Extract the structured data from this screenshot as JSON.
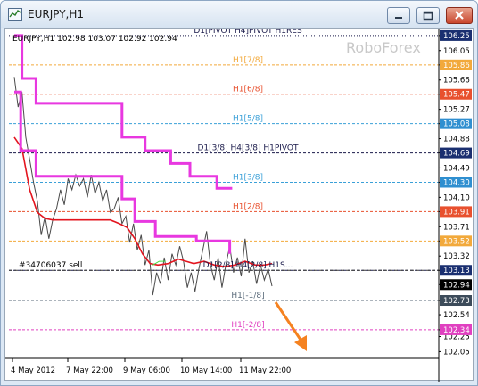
{
  "window": {
    "title": "EURJPY,H1",
    "buttons": {
      "minimize_icon": "minimize-icon",
      "maximize_icon": "maximize-icon",
      "close_icon": "close-icon"
    }
  },
  "chart_data": {
    "type": "line",
    "symbol_info": "EURJPY,H1   102.98 103.07 102.92 102.94",
    "watermark": "RoboForex",
    "ylim": [
      101.96,
      106.32
    ],
    "y_ticks": [
      "106.25",
      "106.05",
      "105.86",
      "105.66",
      "105.47",
      "105.27",
      "105.08",
      "104.88",
      "104.69",
      "104.49",
      "104.30",
      "104.10",
      "103.91",
      "103.71",
      "103.52",
      "103.32",
      "103.13",
      "102.94",
      "102.73",
      "102.54",
      "102.34",
      "102.25",
      "102.05"
    ],
    "x_ticks": [
      "4 May 2012",
      "7 May 22:00",
      "9 May 06:00",
      "10 May 14:00",
      "11 May 22:00"
    ],
    "current_price": "102.94",
    "levels": [
      {
        "label": "D1[PIVOT H4]PIVOT H1RES",
        "value": 106.25,
        "color": "#1a1a4a",
        "tag_bg": "#1a2f70",
        "style": "dot"
      },
      {
        "label": "H1[7/8]",
        "value": 105.86,
        "color": "#f2a93b",
        "tag_bg": "#f2a93b",
        "style": "dash"
      },
      {
        "label": "H1[6/8]",
        "value": 105.47,
        "color": "#e8502e",
        "tag_bg": "#e8502e",
        "style": "dash"
      },
      {
        "label": "H1[5/8]",
        "value": 105.08,
        "color": "#3aa0d8",
        "tag_bg": "#2f8fd0",
        "style": "dash"
      },
      {
        "label": "D1[3/8] H4[3/8] H1PIVOT",
        "value": 104.69,
        "color": "#1a1a4a",
        "tag_bg": "#1a2f70",
        "style": "dash"
      },
      {
        "label": "H1[3/8]",
        "value": 104.3,
        "color": "#3aa0d8",
        "tag_bg": "#2f8fd0",
        "style": "dash"
      },
      {
        "label": "H1[2/8]",
        "value": 103.91,
        "color": "#e8502e",
        "tag_bg": "#e8502e",
        "style": "dash"
      },
      {
        "label": "",
        "value": 103.52,
        "color": "#f2a93b",
        "tag_bg": "#f2a93b",
        "style": "dash"
      },
      {
        "label": "D1[2/8] H4[2/8] H1S...",
        "value": 103.13,
        "color": "#1a1a4a",
        "tag_bg": "#1a2f70",
        "style": "dash"
      },
      {
        "label": "H1[-1/8]",
        "value": 102.73,
        "color": "#5a6a7a",
        "tag_bg": "#3c4b5a",
        "style": "dash"
      },
      {
        "label": "H1[-2/8]",
        "value": 102.34,
        "color": "#e040c0",
        "tag_bg": "#e040c0",
        "style": "dash"
      }
    ],
    "trade_line": {
      "label": "#34706037 sell",
      "value": 103.13
    },
    "series": [
      {
        "name": "",
        "color": "#4a4a4a",
        "kind": "price",
        "points": [
          [
            0,
            105.7
          ],
          [
            3,
            105.3
          ],
          [
            6,
            105.5
          ],
          [
            9,
            104.9
          ],
          [
            12,
            104.6
          ],
          [
            15,
            104.3
          ],
          [
            18,
            104.05
          ],
          [
            21,
            103.6
          ],
          [
            24,
            103.85
          ],
          [
            27,
            103.55
          ],
          [
            30,
            103.8
          ],
          [
            33,
            103.95
          ],
          [
            36,
            104.2
          ],
          [
            39,
            104.0
          ],
          [
            42,
            104.35
          ],
          [
            45,
            104.2
          ],
          [
            48,
            104.4
          ],
          [
            51,
            104.25
          ],
          [
            54,
            104.35
          ],
          [
            57,
            104.1
          ],
          [
            60,
            104.4
          ],
          [
            63,
            104.15
          ],
          [
            66,
            104.3
          ],
          [
            69,
            104.05
          ],
          [
            72,
            104.2
          ],
          [
            75,
            103.9
          ],
          [
            78,
            103.95
          ],
          [
            81,
            104.1
          ],
          [
            84,
            103.75
          ],
          [
            87,
            103.85
          ],
          [
            90,
            103.5
          ],
          [
            93,
            103.75
          ],
          [
            96,
            103.4
          ],
          [
            99,
            103.6
          ],
          [
            102,
            103.2
          ],
          [
            105,
            103.4
          ],
          [
            108,
            102.8
          ],
          [
            111,
            103.1
          ],
          [
            114,
            102.95
          ],
          [
            117,
            103.3
          ],
          [
            120,
            103.0
          ],
          [
            123,
            103.35
          ],
          [
            126,
            103.2
          ],
          [
            129,
            103.45
          ],
          [
            132,
            103.25
          ],
          [
            135,
            102.9
          ],
          [
            138,
            103.1
          ],
          [
            141,
            102.85
          ],
          [
            144,
            103.15
          ],
          [
            147,
            103.4
          ],
          [
            150,
            103.65
          ],
          [
            153,
            103.2
          ],
          [
            156,
            103.0
          ],
          [
            159,
            103.3
          ],
          [
            162,
            102.9
          ],
          [
            165,
            103.2
          ],
          [
            168,
            103.45
          ],
          [
            171,
            103.1
          ],
          [
            174,
            103.3
          ],
          [
            177,
            103.05
          ],
          [
            180,
            103.55
          ],
          [
            183,
            103.1
          ],
          [
            186,
            103.25
          ],
          [
            189,
            102.95
          ],
          [
            192,
            103.2
          ],
          [
            195,
            103.0
          ],
          [
            198,
            103.15
          ],
          [
            201,
            102.92
          ]
        ]
      },
      {
        "name": "",
        "color": "#e3141e",
        "kind": "ma",
        "points": [
          [
            0,
            104.9
          ],
          [
            6,
            104.75
          ],
          [
            12,
            104.2
          ],
          [
            18,
            103.9
          ],
          [
            24,
            103.82
          ],
          [
            30,
            103.8
          ],
          [
            40,
            103.8
          ],
          [
            55,
            103.8
          ],
          [
            65,
            103.8
          ],
          [
            75,
            103.8
          ],
          [
            82,
            103.75
          ],
          [
            88,
            103.7
          ],
          [
            94,
            103.55
          ],
          [
            100,
            103.35
          ],
          [
            106,
            103.22
          ],
          [
            112,
            103.2
          ],
          [
            120,
            103.22
          ],
          [
            128,
            103.28
          ],
          [
            134,
            103.25
          ],
          [
            140,
            103.22
          ],
          [
            148,
            103.25
          ],
          [
            156,
            103.2
          ],
          [
            164,
            103.18
          ],
          [
            172,
            103.2
          ],
          [
            180,
            103.25
          ],
          [
            188,
            103.2
          ],
          [
            195,
            103.2
          ],
          [
            201,
            103.22
          ]
        ]
      },
      {
        "name": "",
        "color": "#e838e0",
        "kind": "envelope-upper",
        "points": [
          [
            0,
            106.25
          ],
          [
            6,
            106.25
          ],
          [
            6,
            105.68
          ],
          [
            17,
            105.68
          ],
          [
            17,
            105.35
          ],
          [
            84,
            105.35
          ],
          [
            84,
            104.9
          ],
          [
            102,
            104.9
          ],
          [
            102,
            104.72
          ],
          [
            122,
            104.72
          ],
          [
            122,
            104.55
          ],
          [
            137,
            104.55
          ],
          [
            137,
            104.38
          ],
          [
            158,
            104.38
          ],
          [
            158,
            104.22
          ],
          [
            170,
            104.22
          ]
        ]
      },
      {
        "name": "",
        "color": "#e838e0",
        "kind": "envelope-lower",
        "points": [
          [
            0,
            105.5
          ],
          [
            5,
            105.5
          ],
          [
            5,
            104.72
          ],
          [
            17,
            104.72
          ],
          [
            17,
            104.38
          ],
          [
            84,
            104.38
          ],
          [
            84,
            104.08
          ],
          [
            94,
            104.08
          ],
          [
            94,
            103.78
          ],
          [
            110,
            103.78
          ],
          [
            110,
            103.58
          ],
          [
            142,
            103.58
          ],
          [
            142,
            103.52
          ],
          [
            168,
            103.52
          ],
          [
            168,
            103.35
          ]
        ]
      },
      {
        "name": "",
        "color": "#44dd44",
        "kind": "segment",
        "points": [
          [
            108,
            103.2
          ],
          [
            113,
            103.25
          ],
          [
            118,
            103.25
          ]
        ]
      }
    ],
    "arrow": {
      "color": "#f58220",
      "direction": "down-right"
    }
  }
}
